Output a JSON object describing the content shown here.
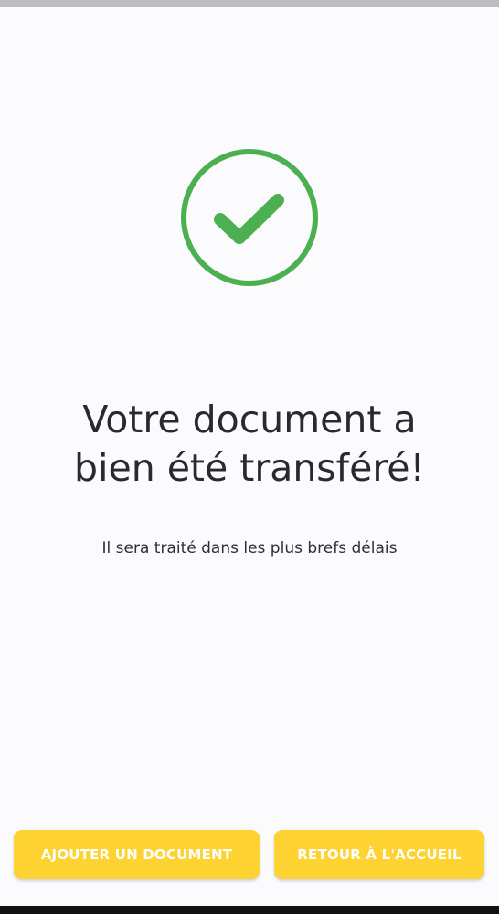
{
  "confirmation": {
    "title_line1": "Votre document a",
    "title_line2": "bien été transféré!",
    "subtitle": "Il sera traité dans les plus brefs délais"
  },
  "actions": {
    "add_document_label": "AJOUTER UN DOCUMENT",
    "back_home_label": "RETOUR À L'ACCUEIL"
  },
  "icons": {
    "status": "checkmark-circle-icon"
  },
  "colors": {
    "success_green": "#4caf50",
    "button_yellow": "#fdd231",
    "button_text": "#ffffff",
    "text": "#2b2b2e",
    "background": "#fbfbfd"
  }
}
